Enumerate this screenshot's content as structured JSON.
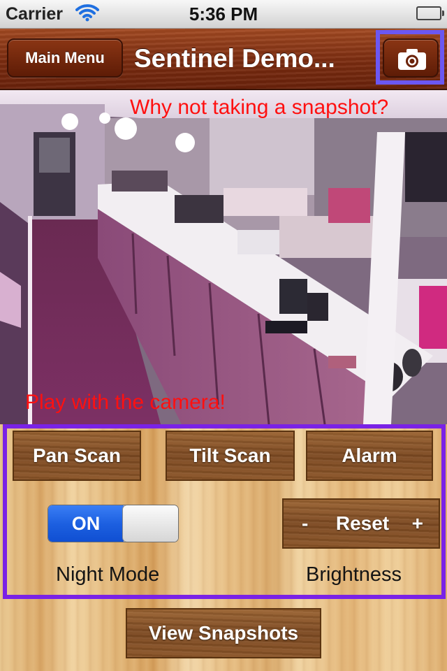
{
  "status_bar": {
    "carrier": "Carrier",
    "time": "5:36 PM",
    "icons": [
      "wifi-icon",
      "battery-icon"
    ]
  },
  "nav_bar": {
    "back_label": "Main Menu",
    "title": "Sentinel Demo...",
    "snapshot_icon": "camera-icon"
  },
  "feed": {
    "hint_snapshot": "Why not taking a snapshot?",
    "hint_camera": "Play with the camera!"
  },
  "controls": {
    "pan_scan": "Pan Scan",
    "tilt_scan": "Tilt Scan",
    "alarm": "Alarm",
    "night_mode_toggle": "ON",
    "night_mode_label": "Night Mode",
    "brightness_minus": "-",
    "brightness_reset": "Reset",
    "brightness_plus": "+",
    "brightness_label": "Brightness"
  },
  "footer": {
    "view_snapshots": "View Snapshots"
  },
  "colors": {
    "hint_text": "#ff1010",
    "highlight_frame": "#7a22e6",
    "camera_highlight": "#6b57f2",
    "toggle_on": "#1c5fe0",
    "navbar": "#7b2c10"
  }
}
